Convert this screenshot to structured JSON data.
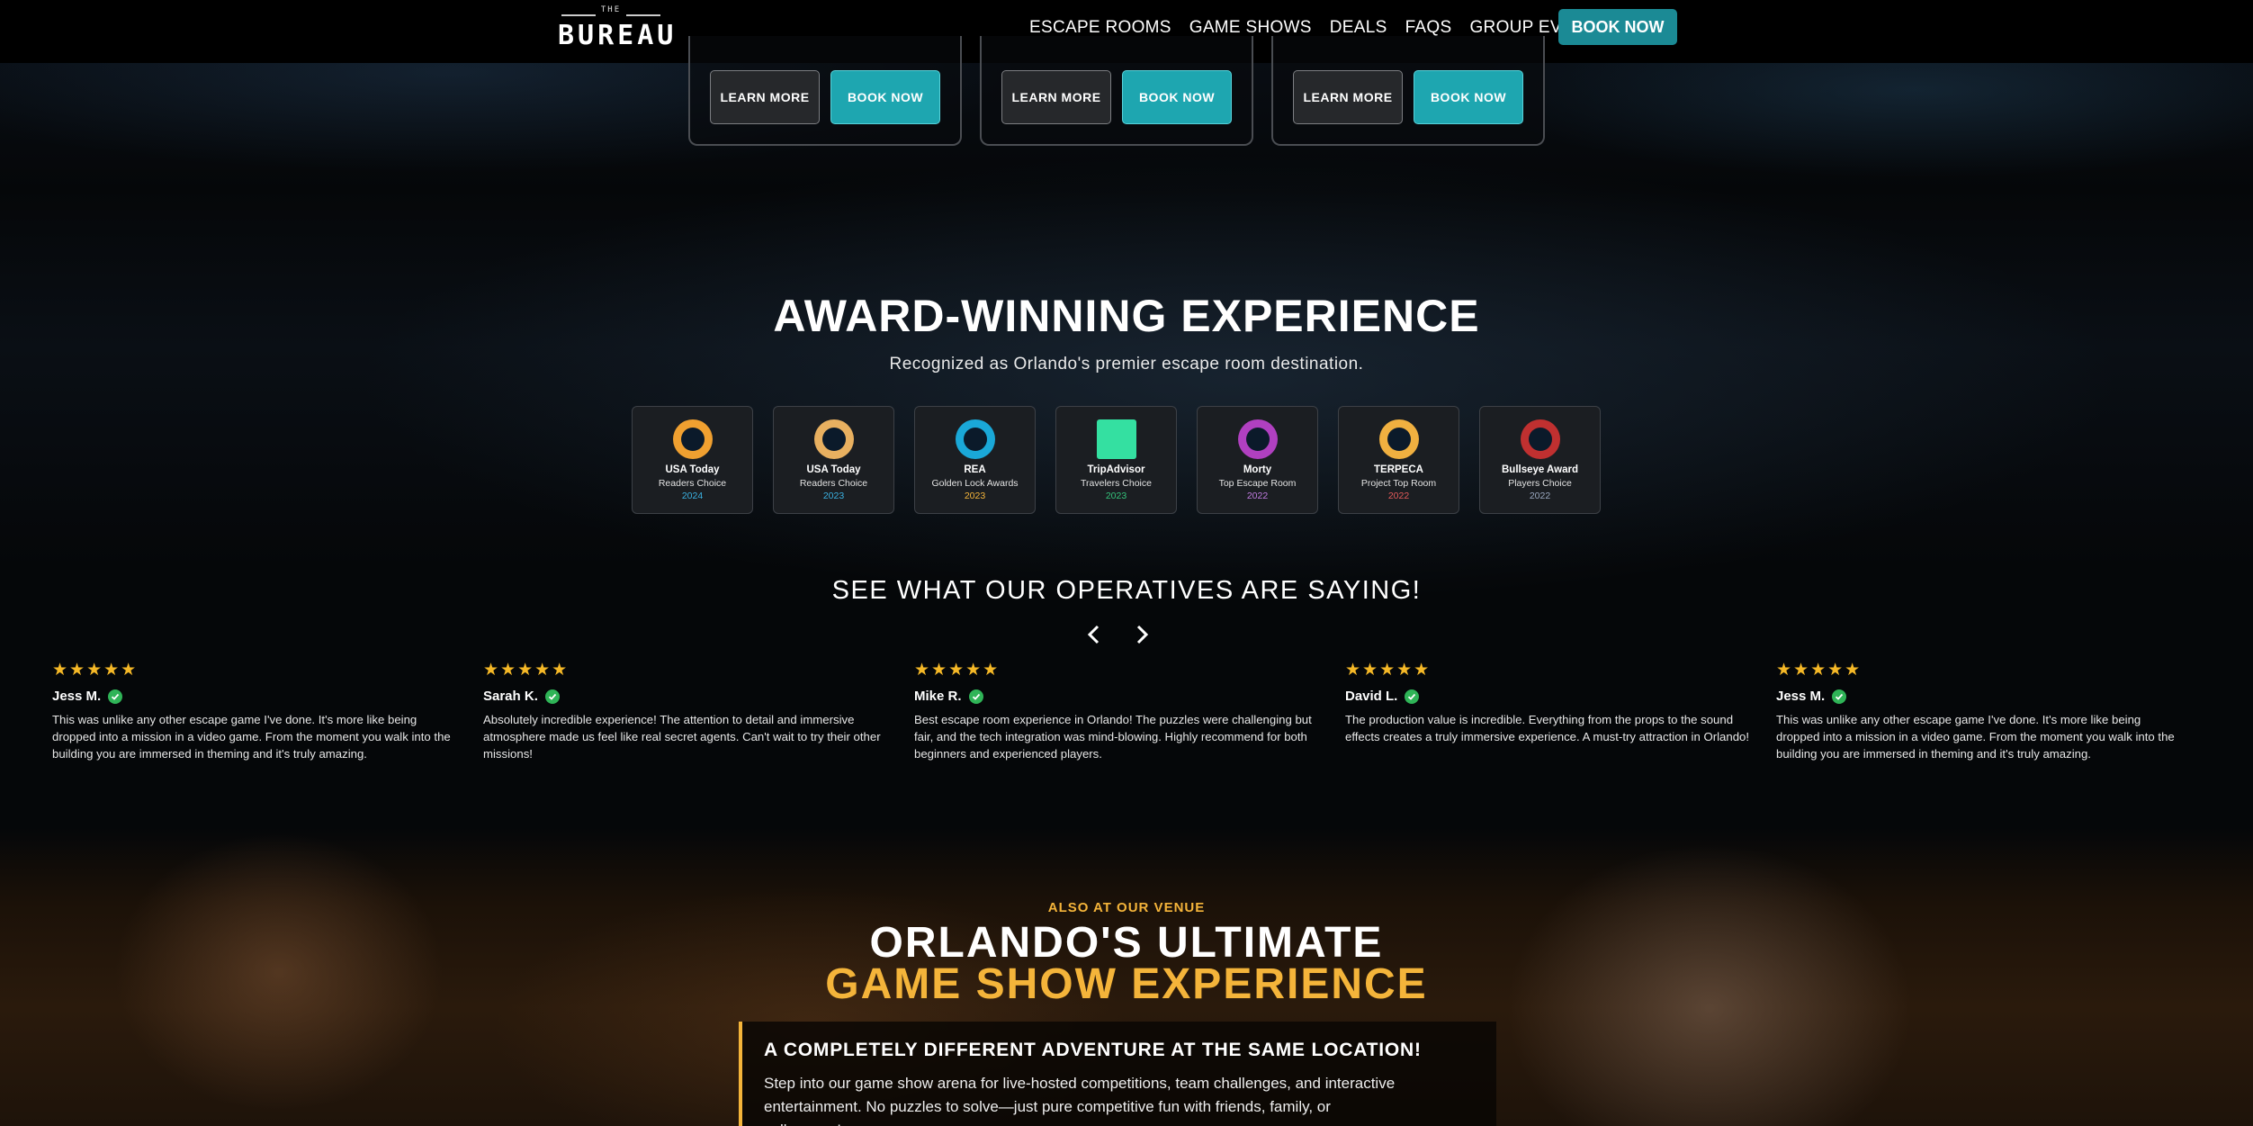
{
  "nav": {
    "logo_top": "THE",
    "logo_main": "BUREAU",
    "links": [
      "ESCAPE ROOMS",
      "GAME SHOWS",
      "DEALS",
      "FAQS",
      "GROUP EVENTS"
    ],
    "book_now": "BOOK NOW"
  },
  "room_cards": [
    {
      "learn": "LEARN MORE",
      "book": "BOOK NOW"
    },
    {
      "learn": "LEARN MORE",
      "book": "BOOK NOW"
    },
    {
      "learn": "LEARN MORE",
      "book": "BOOK NOW"
    }
  ],
  "awards_section": {
    "title": "AWARD-WINNING EXPERIENCE",
    "subtitle": "Recognized as Orlando's premier escape room destination.",
    "awards": [
      {
        "name": "USA Today",
        "sub": "Readers Choice",
        "year": "2024",
        "year_color": "#3ab0e0",
        "badge_color": "#f0a030",
        "icon": "usa-today-badge"
      },
      {
        "name": "USA Today",
        "sub": "Readers Choice",
        "year": "2023",
        "year_color": "#3ab0e0",
        "badge_color": "#e8b060",
        "icon": "usa-today-badge"
      },
      {
        "name": "REA",
        "sub": "Golden Lock Awards",
        "year": "2023",
        "year_color": "#f4b43a",
        "badge_color": "#1aa8d8",
        "icon": "rea-badge"
      },
      {
        "name": "TripAdvisor",
        "sub": "Travelers Choice",
        "year": "2023",
        "year_color": "#34c27a",
        "badge_color": "#34e0a1",
        "icon": "tripadvisor-badge"
      },
      {
        "name": "Morty",
        "sub": "Top Escape Room",
        "year": "2022",
        "year_color": "#c07be0",
        "badge_color": "#b040c0",
        "icon": "morty-badge"
      },
      {
        "name": "TERPECA",
        "sub": "Project Top Room",
        "year": "2022",
        "year_color": "#e35a5a",
        "badge_color": "#f0b040",
        "icon": "terpeca-badge"
      },
      {
        "name": "Bullseye Award",
        "sub": "Players Choice",
        "year": "2022",
        "year_color": "#9aa8c0",
        "badge_color": "#c03030",
        "icon": "bullseye-badge"
      }
    ]
  },
  "reviews_section": {
    "title": "SEE WHAT OUR OPERATIVES ARE SAYING!",
    "reviews": [
      {
        "stars": "★★★★★",
        "name": "Jess M.",
        "text": "This was unlike any other escape game I've done. It's more like being dropped into a mission in a video game. From the moment you walk into the building you are immersed in theming and it's truly amazing."
      },
      {
        "stars": "★★★★★",
        "name": "Sarah K.",
        "text": "Absolutely incredible experience! The attention to detail and immersive atmosphere made us feel like real secret agents. Can't wait to try their other missions!"
      },
      {
        "stars": "★★★★★",
        "name": "Mike R.",
        "text": "Best escape room experience in Orlando! The puzzles were challenging but fair, and the tech integration was mind-blowing. Highly recommend for both beginners and experienced players."
      },
      {
        "stars": "★★★★★",
        "name": "David L.",
        "text": "The production value is incredible. Everything from the props to the sound effects creates a truly immersive experience. A must-try attraction in Orlando!"
      },
      {
        "stars": "★★★★★",
        "name": "Jess M.",
        "text": "This was unlike any other escape game I've done. It's more like being dropped into a mission in a video game. From the moment you walk into the building you are immersed in theming and it's truly amazing."
      }
    ]
  },
  "game_show": {
    "eyebrow": "ALSO AT OUR VENUE",
    "title_line1": "ORLANDO'S ULTIMATE",
    "title_line2": "GAME SHOW EXPERIENCE",
    "box_heading": "A COMPLETELY DIFFERENT ADVENTURE AT THE SAME LOCATION!",
    "box_text": "Step into our game show arena for live-hosted competitions, team challenges, and interactive entertainment. No puzzles to solve—just pure competitive fun with friends, family, or colleagues!"
  }
}
